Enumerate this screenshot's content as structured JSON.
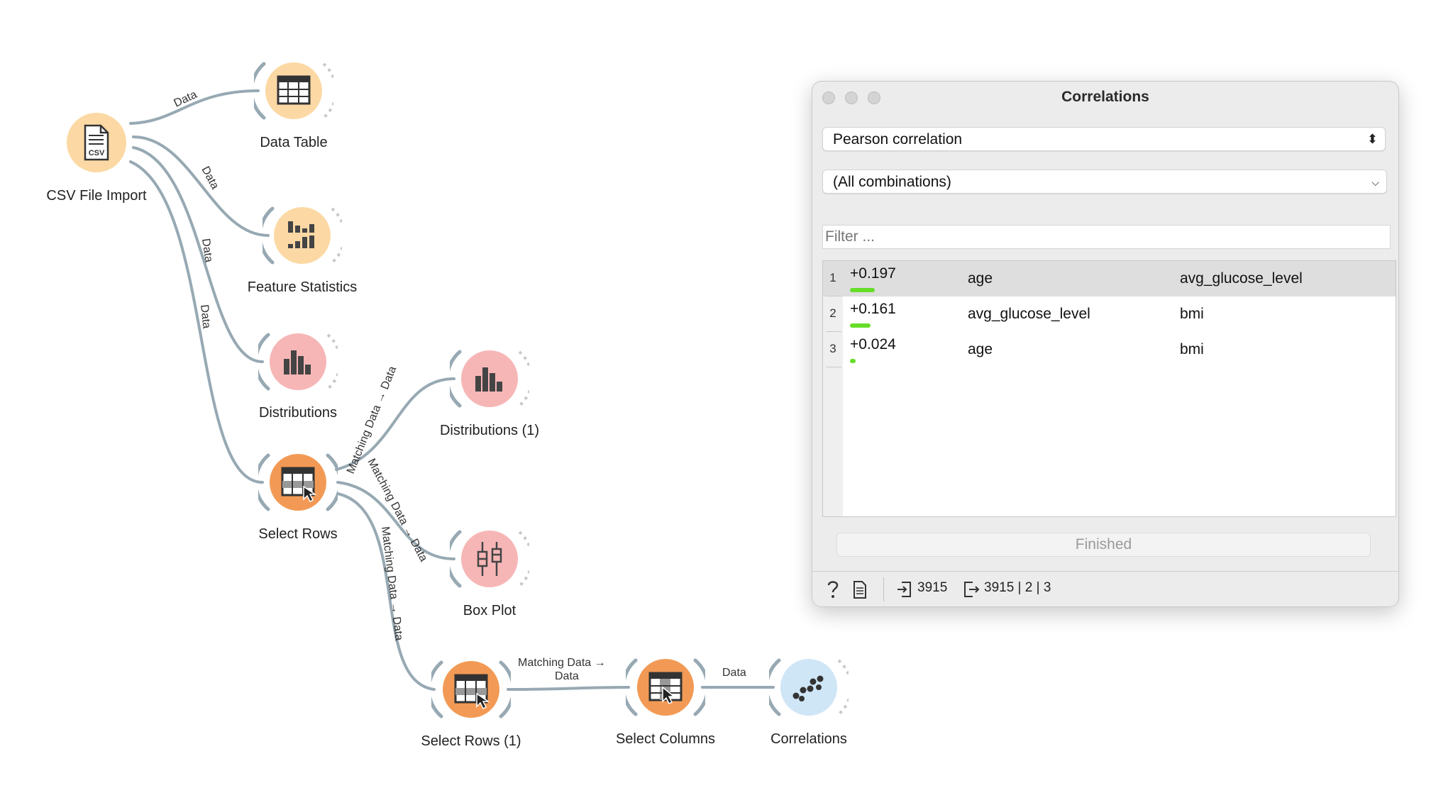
{
  "workflow": {
    "nodes": {
      "csv_import": "CSV File Import",
      "data_table": "Data Table",
      "feature_statistics": "Feature Statistics",
      "distributions": "Distributions",
      "select_rows": "Select Rows",
      "distributions_1": "Distributions (1)",
      "box_plot": "Box Plot",
      "select_rows_1": "Select Rows (1)",
      "select_columns": "Select Columns",
      "correlations": "Correlations"
    },
    "links": {
      "data": "Data",
      "matching_data_to_data": "Matching Data → Data",
      "matching_data_line1": "Matching Data →",
      "matching_data_line2": "Data"
    },
    "icon_text": {
      "csv": "CSV"
    }
  },
  "correlations_window": {
    "title": "Correlations",
    "method": "Pearson correlation",
    "feature": "(All combinations)",
    "filter_placeholder": "Filter ...",
    "rows": [
      {
        "num": "1",
        "value": "+0.197",
        "strength": 0.197,
        "a": "age",
        "b": "avg_glucose_level",
        "selected": true
      },
      {
        "num": "2",
        "value": "+0.161",
        "strength": 0.161,
        "a": "avg_glucose_level",
        "b": "bmi",
        "selected": false
      },
      {
        "num": "3",
        "value": "+0.024",
        "strength": 0.024,
        "a": "age",
        "b": "bmi",
        "selected": false
      }
    ],
    "finished_label": "Finished",
    "status": {
      "input": "3915",
      "output": "3915 | 2 | 3"
    }
  },
  "colors": {
    "orange_light": "#fcd9a4",
    "orange_dark": "#f29a55",
    "red_light": "#f7b6b6",
    "blue_light": "#cfe6f7",
    "link": "#97a9b3",
    "bar": "#66dd2a"
  }
}
